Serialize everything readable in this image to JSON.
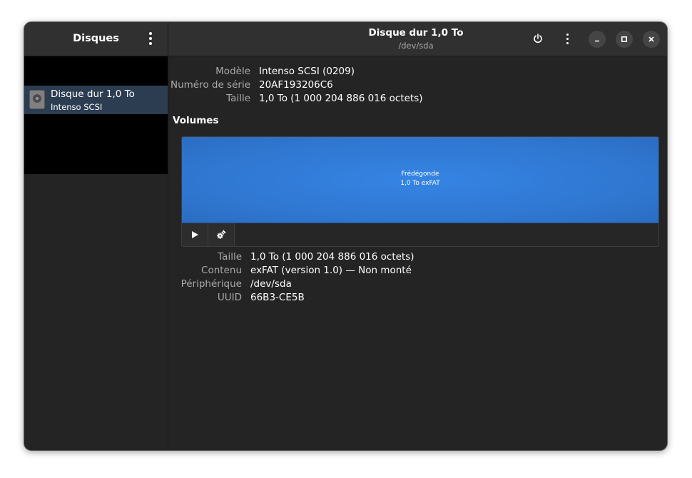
{
  "sidebar": {
    "title": "Disques",
    "drives": [
      {
        "name": "Disque dur 1,0 To",
        "subtitle": "Intenso SCSI"
      }
    ]
  },
  "header": {
    "title": "Disque dur 1,0 To",
    "subtitle": "/dev/sda"
  },
  "drive_info": {
    "model_label": "Modèle",
    "model_value": "Intenso SCSI (0209)",
    "serial_label": "Numéro de série",
    "serial_value": "20AF193206C6",
    "size_label": "Taille",
    "size_value": "1,0 To (1 000 204 886 016 octets)"
  },
  "volumes": {
    "title": "Volumes",
    "partition_name": "Frédégonde",
    "partition_size": "1,0 To exFAT"
  },
  "volume_info": {
    "size_label": "Taille",
    "size_value": "1,0 To (1 000 204 886 016 octets)",
    "content_label": "Contenu",
    "content_value": "exFAT (version 1.0) — Non monté",
    "device_label": "Périphérique",
    "device_value": "/dev/sda",
    "uuid_label": "UUID",
    "uuid_value": "66B3-CE5B"
  },
  "icons": {
    "sidebar_menu": "vertical-dots-icon",
    "power": "power-icon",
    "header_menu": "vertical-dots-icon",
    "minimize": "minimize-icon",
    "maximize": "maximize-icon",
    "close": "close-icon",
    "mount": "play-icon",
    "settings": "gears-icon",
    "drive": "harddisk-icon"
  },
  "colors": {
    "accent": "#3584e4",
    "selection": "#2c3d52",
    "window_bg": "#242424",
    "headerbar_bg": "#303030"
  }
}
